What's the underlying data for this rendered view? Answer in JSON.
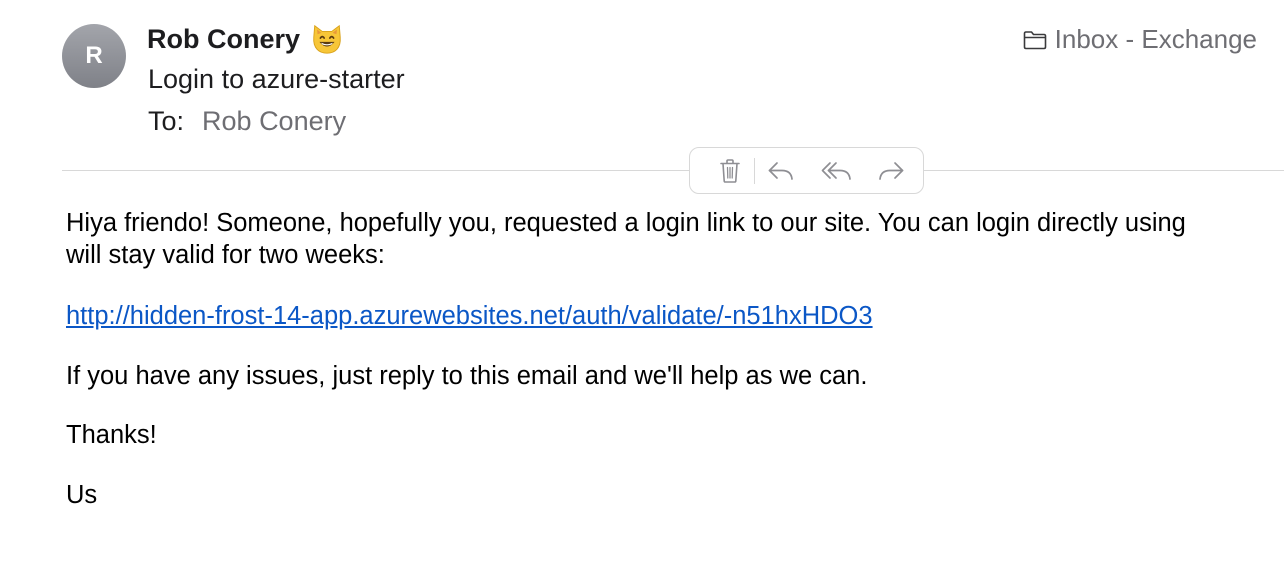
{
  "header": {
    "avatar_initial": "R",
    "sender_name": "Rob Conery",
    "sender_emoji": "smiling-cat-face-icon",
    "subject": "Login to azure-starter",
    "to_label": "To:",
    "to_value": "Rob Conery",
    "mailbox": "Inbox - Exchange",
    "mailbox_icon": "folder-icon"
  },
  "toolbar": {
    "actions": [
      "trash-icon",
      "reply-icon",
      "reply-all-icon",
      "forward-icon"
    ]
  },
  "body": {
    "intro_line1": "Hiya friendo! Someone, hopefully you, requested a login link to our site. You can login directly using",
    "intro_line2": "will stay valid for two weeks:",
    "link": "http://hidden-frost-14-app.azurewebsites.net/auth/validate/-n51hxHDO3",
    "issues": "If you have any issues, just reply to this email and we'll help as we can.",
    "thanks": "Thanks!",
    "signoff": "Us"
  },
  "colors": {
    "link": "#0b57c6",
    "secondary_text": "#6e6e73",
    "avatar": "#8e9097",
    "divider": "#d8d8d8"
  }
}
